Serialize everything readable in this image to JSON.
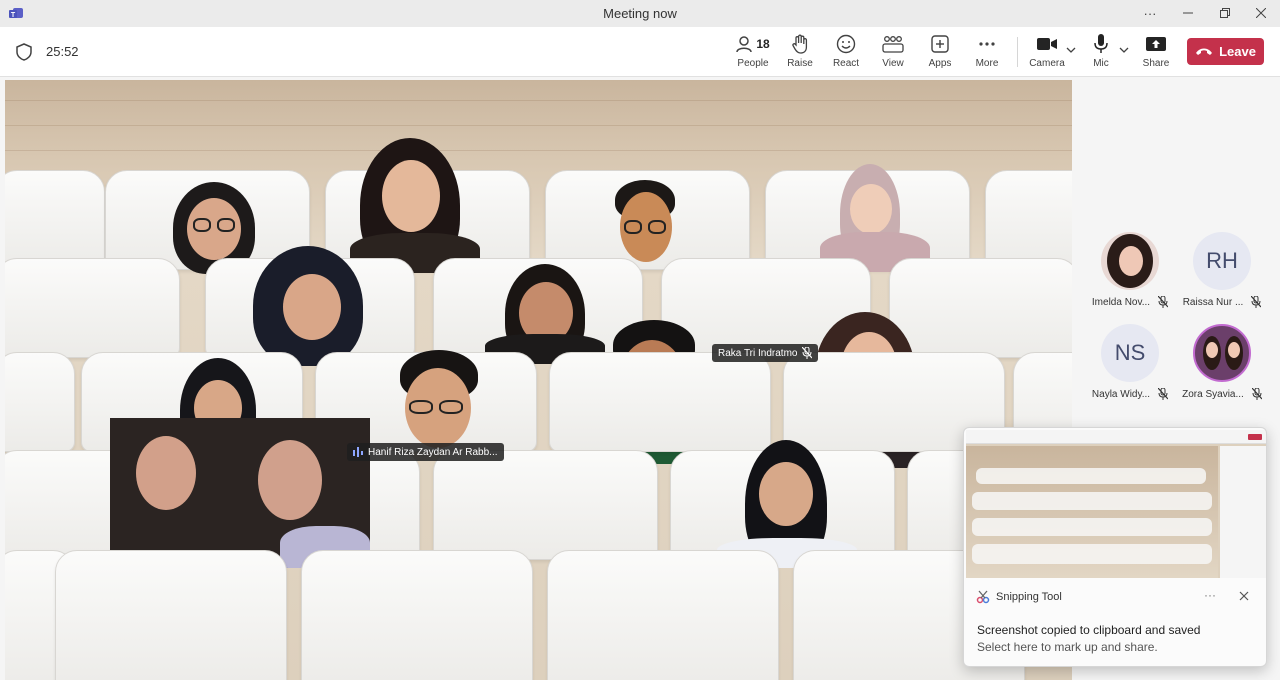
{
  "window": {
    "title": "Meeting now"
  },
  "meeting": {
    "elapsed": "25:52"
  },
  "toolbar": {
    "people_count": "18",
    "people_label": "People",
    "raise_label": "Raise",
    "react_label": "React",
    "view_label": "View",
    "apps_label": "Apps",
    "more_label": "More",
    "camera_label": "Camera",
    "mic_label": "Mic",
    "share_label": "Share",
    "leave_label": "Leave"
  },
  "stage": {
    "name_tags": [
      {
        "name": "Raka Tri Indratmo",
        "muted": true
      },
      {
        "name": "Hanif Riza Zaydan Ar Rabb...",
        "speaking": true
      }
    ]
  },
  "sidebar": {
    "participants": [
      {
        "name": "Imelda Nov...",
        "initials": "",
        "muted": true
      },
      {
        "name": "Raissa Nur ...",
        "initials": "RH",
        "muted": true
      },
      {
        "name": "Nayla Widy...",
        "initials": "NS",
        "muted": true
      },
      {
        "name": "Zora Syavia...",
        "initials": "",
        "muted": true
      }
    ]
  },
  "toast": {
    "app": "Snipping Tool",
    "title": "Screenshot copied to clipboard and saved",
    "subtitle": "Select here to mark up and share."
  },
  "colors": {
    "leave": "#c4314b",
    "accent": "#5b5fc7"
  }
}
